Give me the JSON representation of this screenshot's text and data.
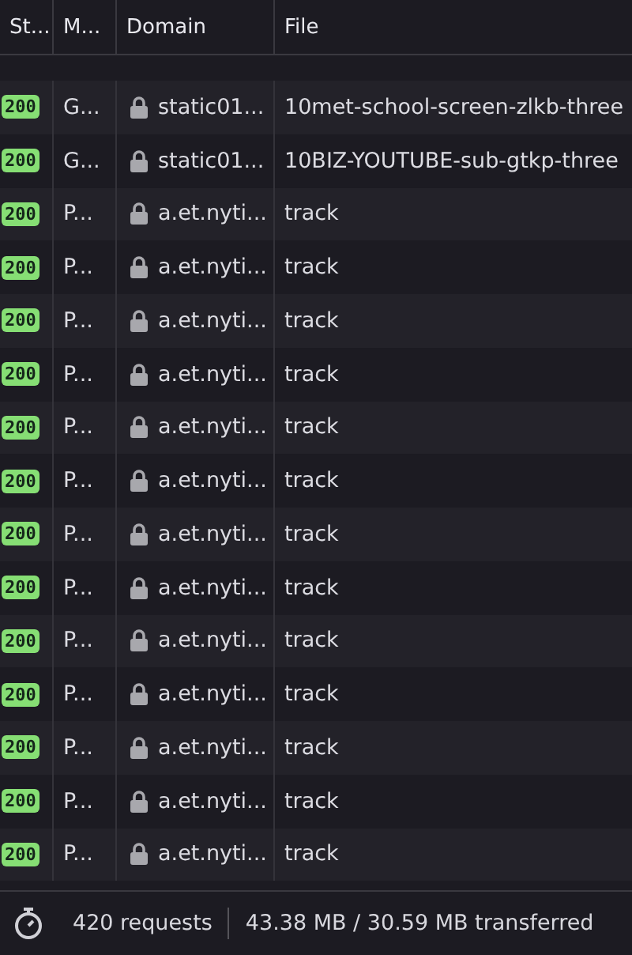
{
  "columns": [
    "St...",
    "M...",
    "Domain",
    "File"
  ],
  "rows": [
    {
      "status": "200",
      "method": "G...",
      "secure": true,
      "domain": "static01...",
      "file": "10met-school-screen-zlkb-three"
    },
    {
      "status": "200",
      "method": "G...",
      "secure": true,
      "domain": "static01...",
      "file": "10BIZ-YOUTUBE-sub-gtkp-three"
    },
    {
      "status": "200",
      "method": "P...",
      "secure": true,
      "domain": "a.et.nyti...",
      "file": "track"
    },
    {
      "status": "200",
      "method": "P...",
      "secure": true,
      "domain": "a.et.nyti...",
      "file": "track"
    },
    {
      "status": "200",
      "method": "P...",
      "secure": true,
      "domain": "a.et.nyti...",
      "file": "track"
    },
    {
      "status": "200",
      "method": "P...",
      "secure": true,
      "domain": "a.et.nyti...",
      "file": "track"
    },
    {
      "status": "200",
      "method": "P...",
      "secure": true,
      "domain": "a.et.nyti...",
      "file": "track"
    },
    {
      "status": "200",
      "method": "P...",
      "secure": true,
      "domain": "a.et.nyti...",
      "file": "track"
    },
    {
      "status": "200",
      "method": "P...",
      "secure": true,
      "domain": "a.et.nyti...",
      "file": "track"
    },
    {
      "status": "200",
      "method": "P...",
      "secure": true,
      "domain": "a.et.nyti...",
      "file": "track"
    },
    {
      "status": "200",
      "method": "P...",
      "secure": true,
      "domain": "a.et.nyti...",
      "file": "track"
    },
    {
      "status": "200",
      "method": "P...",
      "secure": true,
      "domain": "a.et.nyti...",
      "file": "track"
    },
    {
      "status": "200",
      "method": "P...",
      "secure": true,
      "domain": "a.et.nyti...",
      "file": "track"
    },
    {
      "status": "200",
      "method": "P...",
      "secure": true,
      "domain": "a.et.nyti...",
      "file": "track"
    },
    {
      "status": "200",
      "method": "P...",
      "secure": true,
      "domain": "a.et.nyti...",
      "file": "track"
    }
  ],
  "status_bar": {
    "requests": "420 requests",
    "transferred": "43.38 MB / 30.59 MB transferred"
  }
}
